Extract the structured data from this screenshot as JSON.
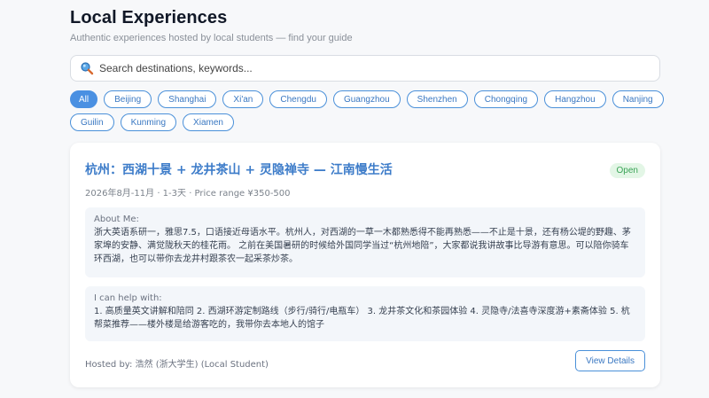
{
  "header": {
    "title": "Local Experiences",
    "subtitle": "Authentic experiences hosted by local students — find your guide"
  },
  "search": {
    "placeholder": "Search destinations, keywords...",
    "value": ""
  },
  "filters": {
    "row1": [
      "All",
      "Beijing",
      "Shanghai",
      "Xi'an",
      "Chengdu",
      "Guangzhou",
      "Shenzhen",
      "Chongqing",
      "Hangzhou",
      "Nanjing"
    ],
    "row2": [
      "Guilin",
      "Kunming",
      "Xiamen"
    ],
    "active": "All"
  },
  "card": {
    "title": "杭州：西湖十景 + 龙井茶山 + 灵隐禅寺 — 江南慢生活",
    "status": "Open",
    "meta": "2026年8月-11月 · 1-3天 · Price range ¥350-500",
    "about_label": "About Me:",
    "about_text": "浙大英语系研一，雅思7.5，口语接近母语水平。杭州人，对西湖的一草一木都熟悉得不能再熟悉——不止是十景，还有杨公堤的野趣、茅家埠的安静、满觉陇秋天的桂花雨。 之前在美国暑研的时候给外国同学当过“杭州地陪”，大家都说我讲故事比导游有意思。可以陪你骑车环西湖，也可以带你去龙井村跟茶农一起采茶炒茶。",
    "help_label": "I can help with:",
    "help_text": "1. 高质量英文讲解和陪同 2. 西湖环游定制路线（步行/骑行/电瓶车） 3. 龙井茶文化和茶园体验 4. 灵隐寺/法喜寺深度游+素斋体验 5. 杭帮菜推荐——楼外楼是给游客吃的，我带你去本地人的馆子",
    "host": "Hosted by: 浩然 (浙大学生) (Local Student)",
    "details_button": "View Details"
  },
  "colors": {
    "accent": "#4a90e2",
    "title_blue": "#3d7cc9",
    "open_green": "#3aa356"
  },
  "icons": {
    "search": "search-icon"
  }
}
